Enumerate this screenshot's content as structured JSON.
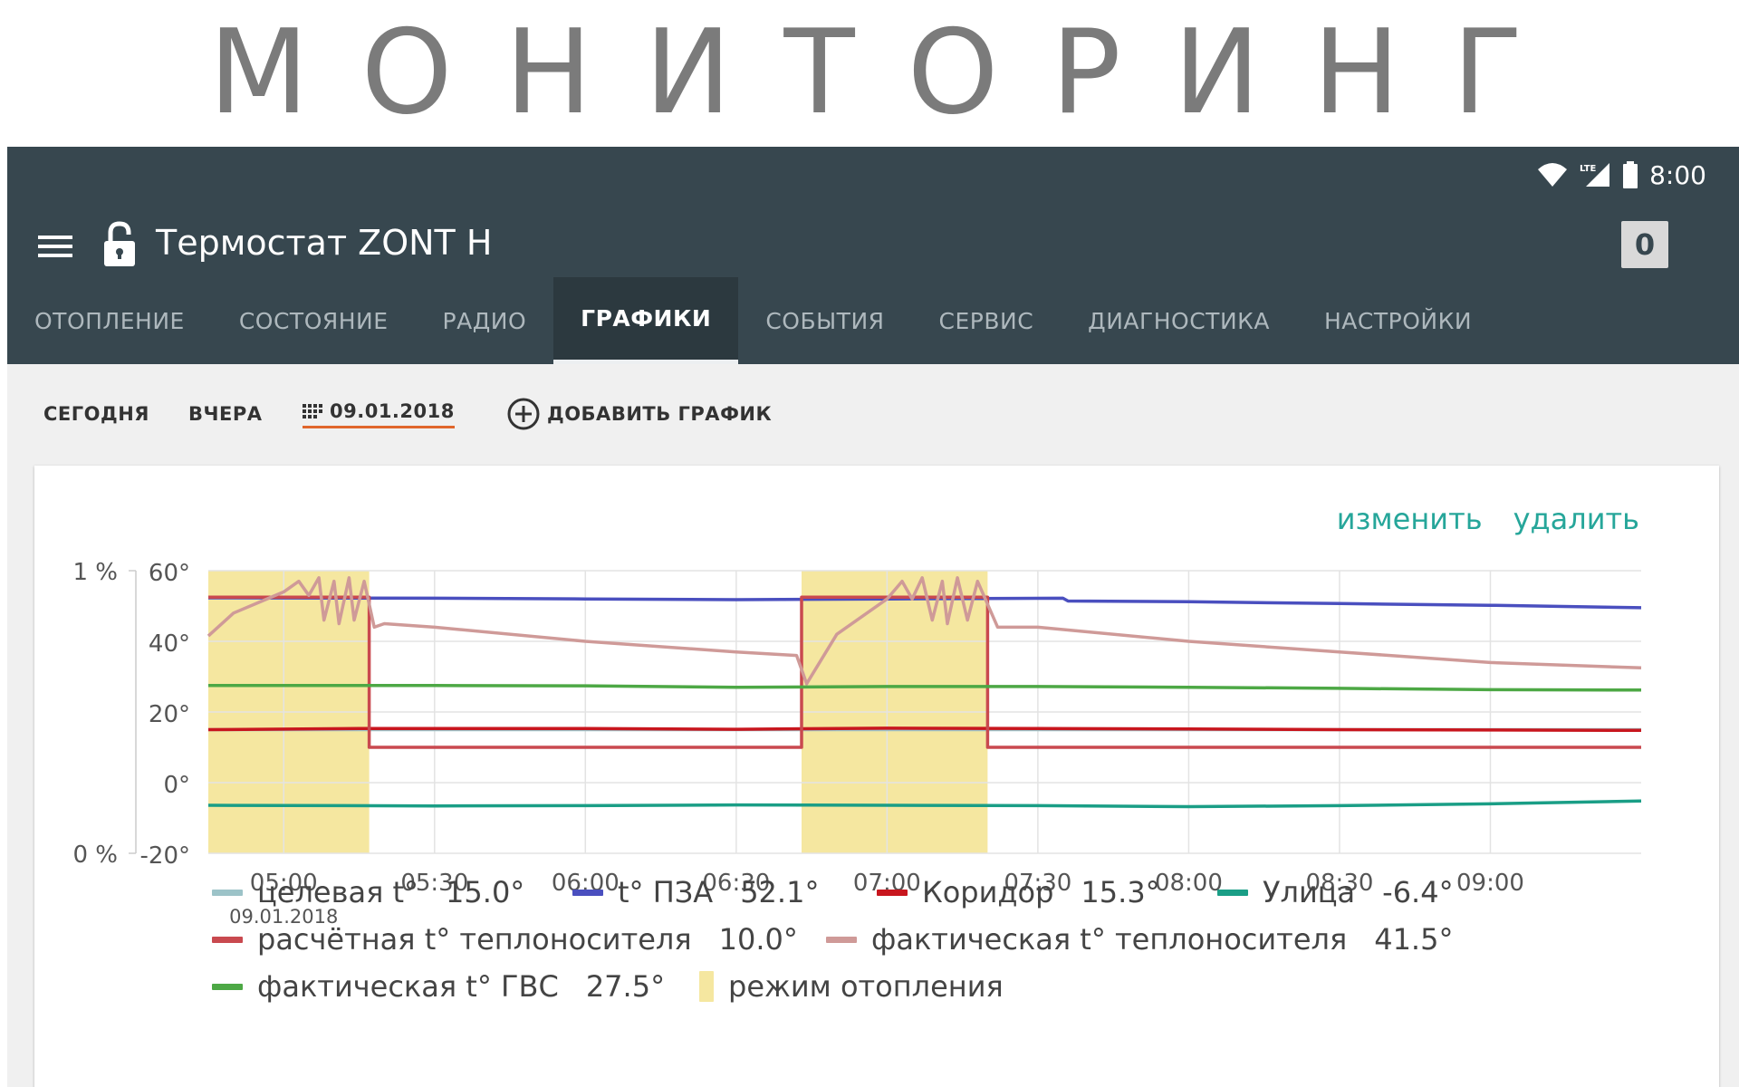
{
  "banner": {
    "title": "МОНИТОРИНГ"
  },
  "status_bar": {
    "network": "LTE",
    "time": "8:00"
  },
  "toolbar": {
    "title": "Термостат ZONT H",
    "badge": "0"
  },
  "tabs": [
    {
      "label": "ОТОПЛЕНИЕ",
      "active": false
    },
    {
      "label": "СОСТОЯНИЕ",
      "active": false
    },
    {
      "label": "РАДИО",
      "active": false
    },
    {
      "label": "ГРАФИКИ",
      "active": true
    },
    {
      "label": "СОБЫТИЯ",
      "active": false
    },
    {
      "label": "СЕРВИС",
      "active": false
    },
    {
      "label": "ДИАГНОСТИКА",
      "active": false
    },
    {
      "label": "НАСТРОЙКИ",
      "active": false
    }
  ],
  "range": {
    "today": "СЕГОДНЯ",
    "yesterday": "ВЧЕРА",
    "date": "09.01.2018",
    "add_chart": "ДОБАВИТЬ ГРАФИК"
  },
  "card_actions": {
    "edit": "изменить",
    "delete": "удалить"
  },
  "colors": {
    "appbar": "#37474f",
    "accent_link": "#26a69a",
    "date_underline": "#e0662c",
    "heating_band": "#f5e7a0",
    "grid": "#e3e3e3"
  },
  "chart_data": {
    "type": "line",
    "y_left": {
      "ylim": [
        0,
        1
      ],
      "ticks": [
        "1 %",
        "0 %"
      ]
    },
    "y_right": {
      "ylim": [
        -20,
        60
      ],
      "ticks": [
        "60°",
        "40°",
        "20°",
        "0°",
        "-20°"
      ]
    },
    "x": {
      "range": [
        "04:45",
        "09:30"
      ],
      "ticks": [
        "05:00",
        "05:30",
        "06:00",
        "06:30",
        "07:00",
        "07:30",
        "08:00",
        "08:30",
        "09:00"
      ],
      "date_label": "09.01.2018"
    },
    "grid": true,
    "heating_periods": [
      [
        "04:45",
        "05:17"
      ],
      [
        "06:43",
        "07:20"
      ]
    ],
    "series": [
      {
        "name": "целевая t°",
        "value_label": "15.0°",
        "color": "#9cc3c8",
        "points": [
          [
            "04:45",
            15.0
          ],
          [
            "09:30",
            15.0
          ]
        ]
      },
      {
        "name": "t° ПЗА",
        "value_label": "52.1°",
        "color": "#4a4fbf",
        "points": [
          [
            "04:45",
            52.3
          ],
          [
            "05:30",
            52.2
          ],
          [
            "06:00",
            52.0
          ],
          [
            "06:30",
            51.8
          ],
          [
            "07:00",
            52.0
          ],
          [
            "07:35",
            52.2
          ],
          [
            "07:36",
            51.4
          ],
          [
            "08:00",
            51.2
          ],
          [
            "08:30",
            50.7
          ],
          [
            "09:00",
            50.2
          ],
          [
            "09:30",
            49.5
          ]
        ]
      },
      {
        "name": "Коридор",
        "value_label": "15.3°",
        "color": "#c8161e",
        "points": [
          [
            "04:45",
            15.0
          ],
          [
            "05:15",
            15.3
          ],
          [
            "06:00",
            15.3
          ],
          [
            "06:30",
            15.1
          ],
          [
            "07:00",
            15.4
          ],
          [
            "07:30",
            15.3
          ],
          [
            "08:00",
            15.2
          ],
          [
            "08:30",
            15.0
          ],
          [
            "09:00",
            14.9
          ],
          [
            "09:30",
            14.8
          ]
        ]
      },
      {
        "name": "Улица",
        "value_label": "-6.4°",
        "color": "#1a9e86",
        "points": [
          [
            "04:45",
            -6.4
          ],
          [
            "05:30",
            -6.6
          ],
          [
            "06:00",
            -6.5
          ],
          [
            "06:30",
            -6.3
          ],
          [
            "07:00",
            -6.4
          ],
          [
            "07:30",
            -6.5
          ],
          [
            "08:00",
            -6.8
          ],
          [
            "08:30",
            -6.5
          ],
          [
            "09:00",
            -6.0
          ],
          [
            "09:30",
            -5.2
          ]
        ]
      },
      {
        "name": "расчётная t° теплоносителя",
        "value_label": "10.0°",
        "color": "#c9494f",
        "points": [
          [
            "04:45",
            52.5
          ],
          [
            "05:17",
            52.5
          ],
          [
            "05:17",
            10.0
          ],
          [
            "06:43",
            10.0
          ],
          [
            "06:43",
            52.5
          ],
          [
            "07:20",
            52.5
          ],
          [
            "07:20",
            10.0
          ],
          [
            "09:30",
            10.0
          ]
        ]
      },
      {
        "name": "фактическая t° теплоносителя",
        "value_label": "41.5°",
        "color": "#cf9a98",
        "points": [
          [
            "04:45",
            41.5
          ],
          [
            "04:50",
            48.0
          ],
          [
            "04:55",
            51.0
          ],
          [
            "05:00",
            54.0
          ],
          [
            "05:03",
            57.0
          ],
          [
            "05:05",
            53.0
          ],
          [
            "05:07",
            58.0
          ],
          [
            "05:08",
            46.0
          ],
          [
            "05:10",
            57.0
          ],
          [
            "05:11",
            45.0
          ],
          [
            "05:13",
            58.0
          ],
          [
            "05:14",
            46.0
          ],
          [
            "05:16",
            57.0
          ],
          [
            "05:18",
            44.0
          ],
          [
            "05:20",
            45.0
          ],
          [
            "05:30",
            44.0
          ],
          [
            "06:00",
            40.0
          ],
          [
            "06:30",
            37.0
          ],
          [
            "06:42",
            36.0
          ],
          [
            "06:44",
            28.0
          ],
          [
            "06:50",
            42.0
          ],
          [
            "07:00",
            52.0
          ],
          [
            "07:03",
            57.0
          ],
          [
            "07:05",
            52.0
          ],
          [
            "07:07",
            58.0
          ],
          [
            "07:09",
            46.0
          ],
          [
            "07:11",
            57.0
          ],
          [
            "07:12",
            45.0
          ],
          [
            "07:14",
            58.0
          ],
          [
            "07:16",
            46.0
          ],
          [
            "07:18",
            57.0
          ],
          [
            "07:22",
            44.0
          ],
          [
            "07:30",
            44.0
          ],
          [
            "08:00",
            40.0
          ],
          [
            "08:30",
            37.0
          ],
          [
            "09:00",
            34.0
          ],
          [
            "09:30",
            32.5
          ]
        ]
      },
      {
        "name": "фактическая t° ГВС",
        "value_label": "27.5°",
        "color": "#4da845",
        "points": [
          [
            "04:45",
            27.5
          ],
          [
            "05:30",
            27.5
          ],
          [
            "06:00",
            27.4
          ],
          [
            "06:30",
            27.0
          ],
          [
            "07:00",
            27.2
          ],
          [
            "07:30",
            27.2
          ],
          [
            "08:00",
            27.0
          ],
          [
            "08:30",
            26.7
          ],
          [
            "09:00",
            26.3
          ],
          [
            "09:30",
            26.2
          ]
        ]
      },
      {
        "name": "режим отопления",
        "value_label": "",
        "color": "#f5e7a0",
        "kind": "band",
        "points": []
      }
    ]
  }
}
